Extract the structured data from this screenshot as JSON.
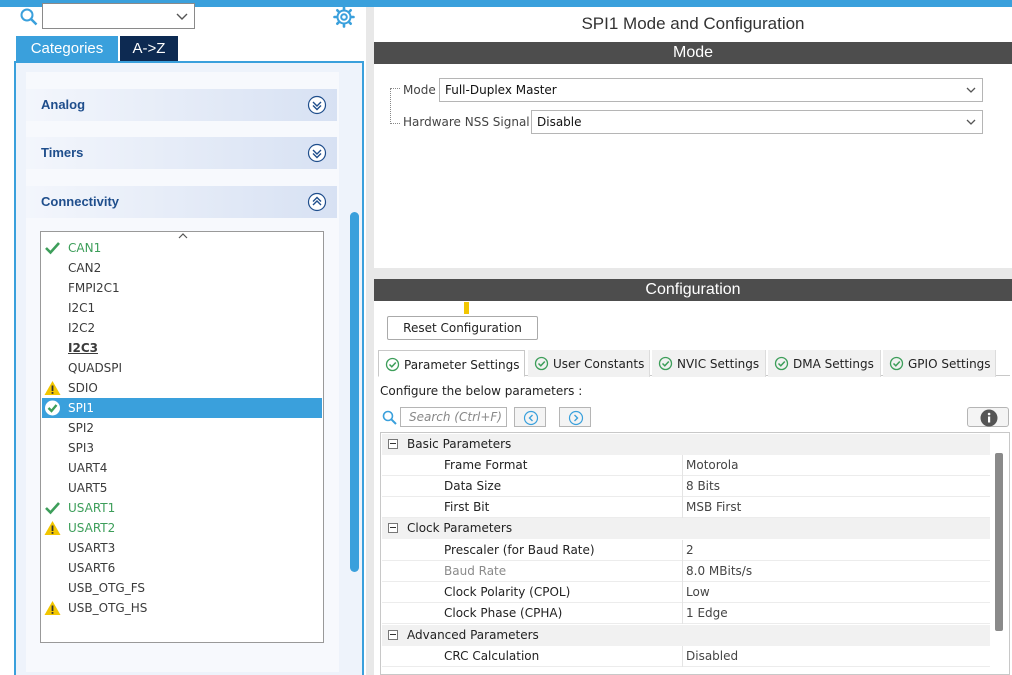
{
  "sidebar": {
    "tabs": {
      "categories": "Categories",
      "az": "A->Z"
    },
    "groups": [
      {
        "label": "Analog"
      },
      {
        "label": "Timers"
      },
      {
        "label": "Connectivity"
      }
    ],
    "peripherals": [
      {
        "label": "CAN1",
        "status": "ok"
      },
      {
        "label": "CAN2",
        "status": "none"
      },
      {
        "label": "FMPI2C1",
        "status": "none"
      },
      {
        "label": "I2C1",
        "status": "none"
      },
      {
        "label": "I2C2",
        "status": "none"
      },
      {
        "label": "I2C3",
        "status": "none"
      },
      {
        "label": "QUADSPI",
        "status": "none"
      },
      {
        "label": "SDIO",
        "status": "warning"
      },
      {
        "label": "SPI1",
        "status": "ok-selected"
      },
      {
        "label": "SPI2",
        "status": "none"
      },
      {
        "label": "SPI3",
        "status": "none"
      },
      {
        "label": "UART4",
        "status": "none"
      },
      {
        "label": "UART5",
        "status": "none"
      },
      {
        "label": "USART1",
        "status": "ok"
      },
      {
        "label": "USART2",
        "status": "warning"
      },
      {
        "label": "USART3",
        "status": "none"
      },
      {
        "label": "USART6",
        "status": "none"
      },
      {
        "label": "USB_OTG_FS",
        "status": "none"
      },
      {
        "label": "USB_OTG_HS",
        "status": "warning"
      }
    ]
  },
  "main": {
    "title": "SPI1 Mode and Configuration",
    "mode_bar": "Mode",
    "mode": {
      "label": "Mode",
      "value": "Full-Duplex Master"
    },
    "nss": {
      "label": "Hardware NSS Signal",
      "value": "Disable"
    },
    "config_bar": "Configuration",
    "reset_button": "Reset Configuration",
    "tabs": [
      {
        "label": "Parameter Settings"
      },
      {
        "label": "User Constants"
      },
      {
        "label": "NVIC Settings"
      },
      {
        "label": "DMA Settings"
      },
      {
        "label": "GPIO Settings"
      }
    ],
    "configure_text": "Configure the below parameters :",
    "search_placeholder": "Search (Ctrl+F)",
    "groups": {
      "basic": "Basic Parameters",
      "clock": "Clock Parameters",
      "advanced": "Advanced Parameters"
    },
    "params": {
      "frame_format": {
        "name": "Frame Format",
        "value": "Motorola"
      },
      "data_size": {
        "name": "Data Size",
        "value": "8 Bits"
      },
      "first_bit": {
        "name": "First Bit",
        "value": "MSB First"
      },
      "prescaler": {
        "name": "Prescaler (for Baud Rate)",
        "value": "2"
      },
      "baud_rate": {
        "name": "Baud Rate",
        "value": "8.0 MBits/s"
      },
      "cpol": {
        "name": "Clock Polarity (CPOL)",
        "value": "Low"
      },
      "cpha": {
        "name": "Clock Phase (CPHA)",
        "value": "1 Edge"
      },
      "crc": {
        "name": "CRC Calculation",
        "value": "Disabled"
      }
    }
  },
  "colors": {
    "accent": "#3aa0dc",
    "header_bar": "#4d4d4d",
    "ok_green": "#3d9e5a",
    "warning_yellow": "#f2c600",
    "group_text": "#1f4e8c"
  }
}
